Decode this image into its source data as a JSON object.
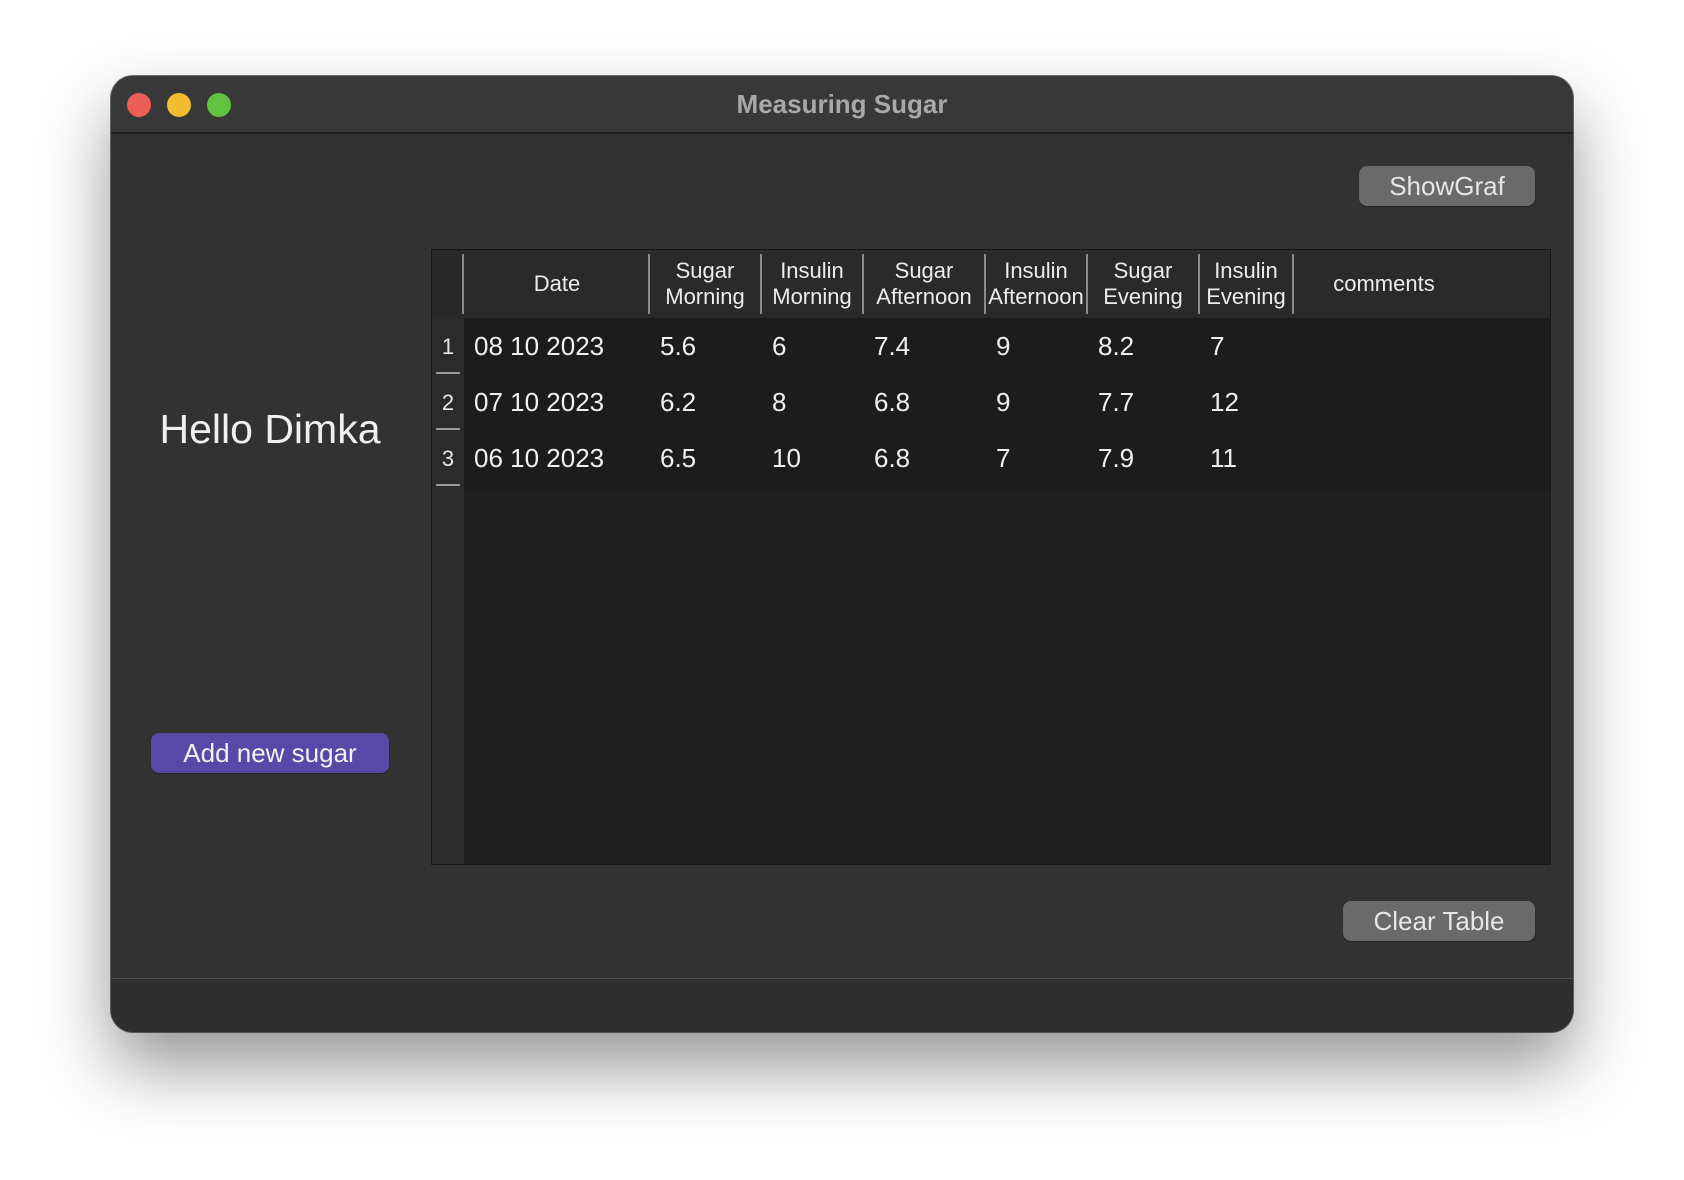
{
  "window": {
    "title": "Measuring Sugar"
  },
  "toolbar": {
    "show_graf_label": "ShowGraf",
    "clear_table_label": "Clear Table"
  },
  "sidebar": {
    "greeting": "Hello Dimka",
    "add_button_label": "Add new sugar"
  },
  "table": {
    "columns": [
      "Date",
      "Sugar\nMorning",
      "Insulin\nMorning",
      "Sugar\nAfternoon",
      "Insulin\nAfternoon",
      "Sugar\nEvening",
      "Insulin\nEvening",
      "comments"
    ],
    "row_numbers": [
      "1",
      "2",
      "3"
    ],
    "rows": [
      [
        "08 10 2023",
        "5.6",
        "6",
        "7.4",
        "9",
        "8.2",
        "7",
        ""
      ],
      [
        "07 10 2023",
        "6.2",
        "8",
        "6.8",
        "9",
        "7.7",
        "12",
        ""
      ],
      [
        "06 10 2023",
        "6.5",
        "10",
        "6.8",
        "7",
        "7.9",
        "11",
        ""
      ]
    ]
  },
  "colors": {
    "window_bg": "#323232",
    "titlebar_bg": "#383838",
    "accent_button": "#5849a9",
    "neutral_button": "#6a6a6a",
    "close": "#ec5f57",
    "minimize": "#f3bc2f",
    "maximize": "#5fc33f"
  }
}
